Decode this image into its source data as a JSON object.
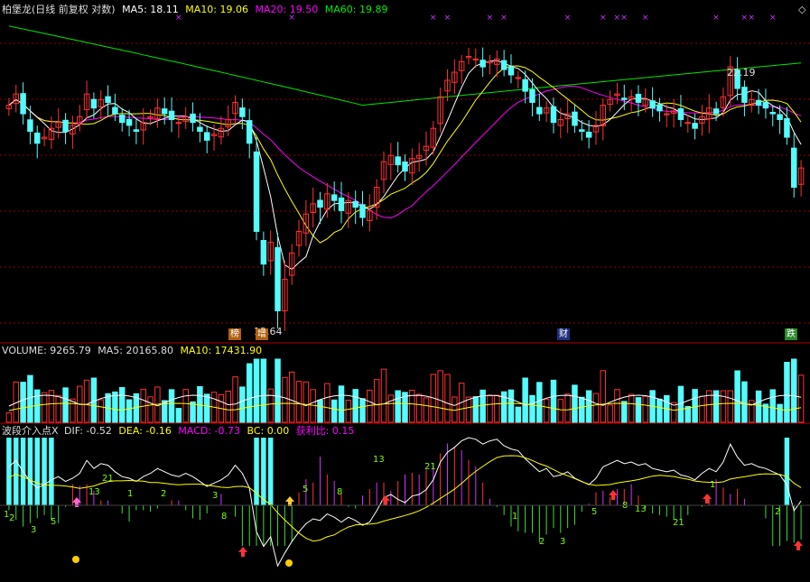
{
  "colors": {
    "background": "#000000",
    "up": "#FF3232",
    "down": "#54FCFC",
    "ma5": "#FFFFFF",
    "ma10": "#FFFF00",
    "ma20": "#FF00FF",
    "ma60": "#00E600",
    "grid": "#8B0000",
    "panel_border": "#B00000",
    "marker": "#CC33FF"
  },
  "price_panel": {
    "title": "柏堡龙(日线 前复权 对数)",
    "ma5_label": "MA5: 18.11",
    "ma10_label": "MA10: 19.06",
    "ma20_label": "MA20: 19.50",
    "ma60_label": "MA60: 19.89",
    "high_label": "22.19",
    "low_label": "13.64",
    "event_tags": [
      "榜",
      "增",
      "财",
      "跌"
    ],
    "top_markers": "×"
  },
  "volume_panel": {
    "vol_label": "VOLUME: 9265.79",
    "ma5_label": "MA5: 20165.80",
    "ma10_label": "MA10: 17431.90"
  },
  "macd_panel": {
    "name_label": "波段介入点X",
    "dif_label": "DIF: -0.52",
    "dea_label": "DEA: -0.16",
    "macd_label": "MACD: -0.73",
    "bc_label": "BC: 0.00",
    "profit_label": "获利比: 0.15",
    "counts": [
      "1",
      "2",
      "3",
      "5",
      "8",
      "13",
      "21"
    ]
  },
  "chart_data": [
    {
      "type": "candlestick",
      "title": "柏堡龙(日线 前复权 对数)",
      "series": [
        {
          "name": "MA5",
          "last": 18.11
        },
        {
          "name": "MA10",
          "last": 19.06
        },
        {
          "name": "MA20",
          "last": 19.5
        },
        {
          "name": "MA60",
          "last": 19.89
        }
      ],
      "annotations": [
        {
          "text": "22.19",
          "kind": "high"
        },
        {
          "text": "13.64",
          "kind": "low"
        }
      ],
      "close_approx": [
        20.2,
        20.6,
        19.9,
        19.3,
        18.9,
        19.1,
        19.4,
        19.6,
        19.3,
        19.5,
        19.8,
        20.6,
        20.1,
        20.4,
        20.3,
        19.9,
        19.6,
        19.5,
        19.3,
        19.6,
        19.8,
        20.1,
        19.9,
        19.7,
        19.6,
        19.8,
        19.6,
        19.3,
        19.0,
        19.2,
        19.4,
        19.7,
        20.3,
        19.8,
        18.9,
        16.2,
        15.3,
        15.9,
        14.1,
        14.9,
        15.6,
        16.2,
        16.7,
        17.0,
        16.9,
        17.3,
        17.1,
        16.8,
        17.1,
        16.9,
        16.6,
        16.8,
        17.5,
        18.3,
        18.5,
        18.2,
        18.0,
        18.4,
        18.5,
        18.8,
        19.4,
        20.5,
        21.1,
        21.4,
        21.8,
        22.0,
        21.9,
        21.6,
        21.8,
        21.9,
        21.5,
        21.3,
        21.2,
        20.7,
        20.3,
        19.9,
        20.1,
        19.6,
        19.7,
        19.9,
        19.5,
        19.3,
        19.1,
        19.5,
        20.2,
        20.4,
        20.6,
        20.4,
        20.5,
        20.3,
        20.4,
        20.1,
        20.0,
        19.9,
        20.0,
        19.7,
        19.6,
        19.4,
        19.8,
        20.1,
        19.9,
        20.5,
        21.6,
        20.8,
        20.3,
        20.4,
        20.2,
        20.1,
        19.9,
        19.7,
        19.1,
        17.5,
        18.1
      ]
    },
    {
      "type": "bar",
      "title": "VOLUME",
      "series": [
        {
          "name": "VOLUME",
          "last": 9265.79
        },
        {
          "name": "MA5",
          "last": 20165.8
        },
        {
          "name": "MA10",
          "last": 17431.9
        }
      ]
    },
    {
      "type": "bar",
      "title": "波段介入点X",
      "series": [
        {
          "name": "DIF",
          "last": -0.52
        },
        {
          "name": "DEA",
          "last": -0.16
        },
        {
          "name": "MACD",
          "last": -0.73
        },
        {
          "name": "BC",
          "last": 0.0
        },
        {
          "name": "获利比",
          "last": 0.15
        }
      ]
    }
  ]
}
